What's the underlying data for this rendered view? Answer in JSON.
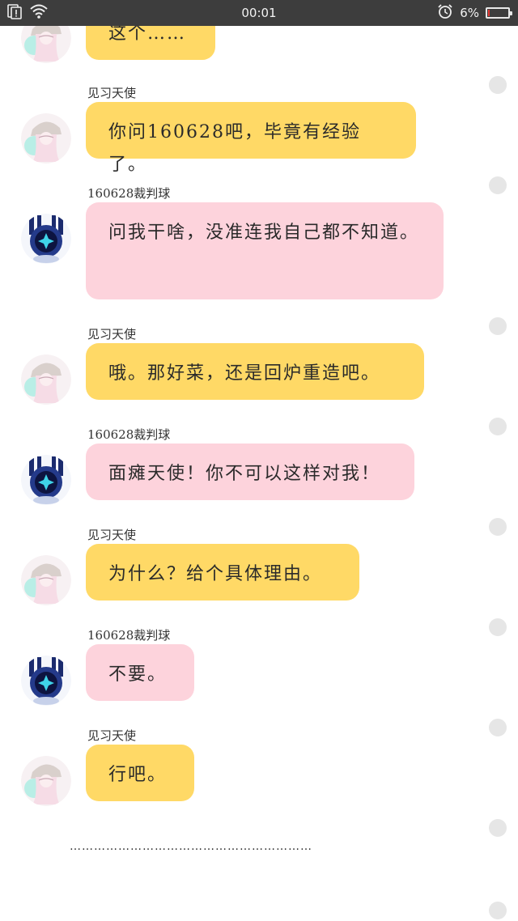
{
  "status_bar": {
    "time": "00:01",
    "battery_percent_label": "6%",
    "battery_level": 0.06,
    "icons": [
      "sim-alert-icon",
      "wifi-icon",
      "alarm-icon",
      "battery-icon"
    ]
  },
  "colors": {
    "yellow_bubble": "#ffd966",
    "pink_bubble": "#fdd3dc",
    "status_bar": "#3d3d3d",
    "battery_low": "#e53935"
  },
  "chat": {
    "messages": [
      {
        "sender": "",
        "text": "这个……",
        "color": "yellow",
        "avatar": "angel-avatar"
      },
      {
        "sender": "见习天使",
        "text": "你问160628吧，毕竟有经验了。",
        "color": "yellow",
        "avatar": "angel-avatar"
      },
      {
        "sender": "160628裁判球",
        "text": "问我干啥，没准连我自己都不知道。",
        "color": "pink",
        "avatar": "robot-avatar"
      },
      {
        "sender": "见习天使",
        "text": "哦。那好菜，还是回炉重造吧。",
        "color": "yellow",
        "avatar": "angel-avatar"
      },
      {
        "sender": "160628裁判球",
        "text": "面瘫天使！你不可以这样对我！",
        "color": "pink",
        "avatar": "robot-avatar"
      },
      {
        "sender": "见习天使",
        "text": "为什么？给个具体理由。",
        "color": "yellow",
        "avatar": "angel-avatar"
      },
      {
        "sender": "160628裁判球",
        "text": "不要。",
        "color": "pink",
        "avatar": "robot-avatar"
      },
      {
        "sender": "见习天使",
        "text": "行吧。",
        "color": "yellow",
        "avatar": "angel-avatar"
      }
    ],
    "ending": "……………………………………………………"
  }
}
